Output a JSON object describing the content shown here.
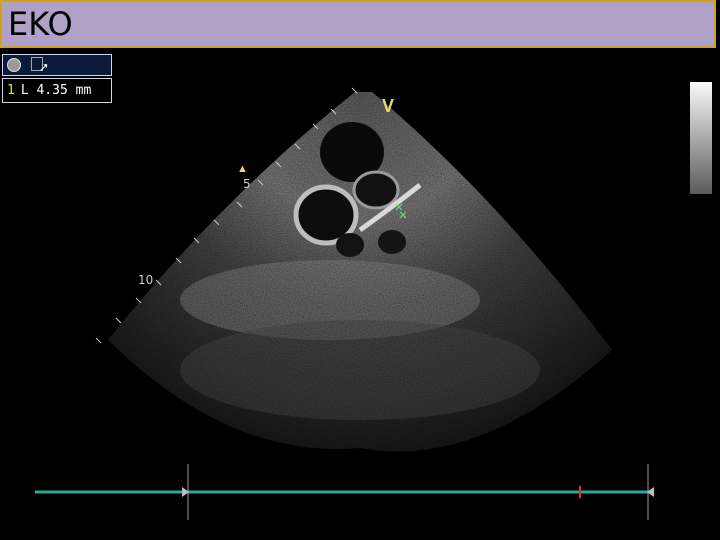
{
  "title": "EKO",
  "measurement": {
    "index": "1",
    "label": "L",
    "value": "4.35 mm"
  },
  "depth_ticks": [
    "5",
    "10"
  ],
  "orientation_marker": "V",
  "colors": {
    "title_bg": "#b1a0c7",
    "title_border": "#c9a227",
    "ecg": "#2fa79a",
    "marker": "#e8d96a"
  },
  "icons": [
    "record-icon",
    "document-icon",
    "cursor-icon",
    "triangle-marker-icon"
  ]
}
